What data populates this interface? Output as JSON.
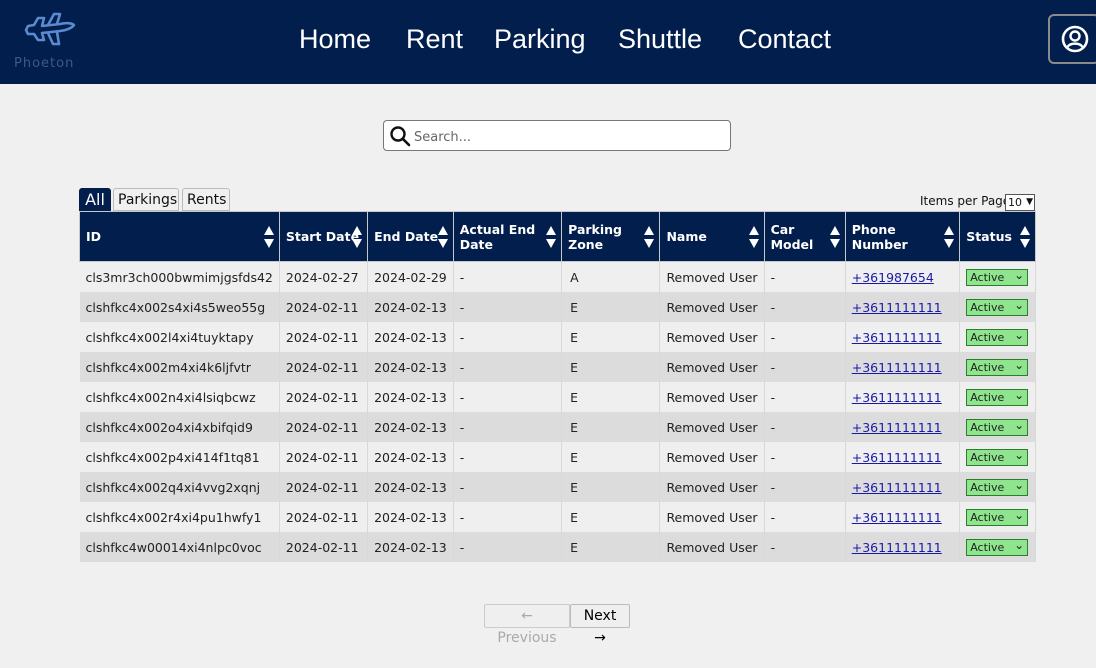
{
  "brand": {
    "name": "Phoeton"
  },
  "nav": {
    "home": "Home",
    "rent": "Rent",
    "parking": "Parking",
    "shuttle": "Shuttle",
    "contact": "Contact"
  },
  "search": {
    "placeholder": "Search..."
  },
  "filters": {
    "all": "All",
    "parkings": "Parkings",
    "rents": "Rents",
    "active": "All"
  },
  "pagination_controls": {
    "items_per_page_label": "Items per Page",
    "items_per_page_value": "10",
    "previous": "← Previous",
    "next": "Next →"
  },
  "table": {
    "headers": [
      "ID",
      "Start Date",
      "End Date",
      "Actual End Date",
      "Parking Zone",
      "Name",
      "Car Model",
      "Phone Number",
      "Status"
    ],
    "rows": [
      {
        "id": "cls3mr3ch000bwmimjgsfds42",
        "start": "2024-02-27",
        "end": "2024-02-29",
        "actual_end": "-",
        "zone": "A",
        "name": "Removed User",
        "car": "-",
        "phone": "+361987654",
        "status": "Active"
      },
      {
        "id": "clshfkc4x002s4xi4s5weo55g",
        "start": "2024-02-11",
        "end": "2024-02-13",
        "actual_end": "-",
        "zone": "E",
        "name": "Removed User",
        "car": "-",
        "phone": "+3611111111",
        "status": "Active"
      },
      {
        "id": "clshfkc4x002l4xi4tuyktapy",
        "start": "2024-02-11",
        "end": "2024-02-13",
        "actual_end": "-",
        "zone": "E",
        "name": "Removed User",
        "car": "-",
        "phone": "+3611111111",
        "status": "Active"
      },
      {
        "id": "clshfkc4x002m4xi4k6ljfvtr",
        "start": "2024-02-11",
        "end": "2024-02-13",
        "actual_end": "-",
        "zone": "E",
        "name": "Removed User",
        "car": "-",
        "phone": "+3611111111",
        "status": "Active"
      },
      {
        "id": "clshfkc4x002n4xi4lsiqbcwz",
        "start": "2024-02-11",
        "end": "2024-02-13",
        "actual_end": "-",
        "zone": "E",
        "name": "Removed User",
        "car": "-",
        "phone": "+3611111111",
        "status": "Active"
      },
      {
        "id": "clshfkc4x002o4xi4xbifqid9",
        "start": "2024-02-11",
        "end": "2024-02-13",
        "actual_end": "-",
        "zone": "E",
        "name": "Removed User",
        "car": "-",
        "phone": "+3611111111",
        "status": "Active"
      },
      {
        "id": "clshfkc4x002p4xi414f1tq81",
        "start": "2024-02-11",
        "end": "2024-02-13",
        "actual_end": "-",
        "zone": "E",
        "name": "Removed User",
        "car": "-",
        "phone": "+3611111111",
        "status": "Active"
      },
      {
        "id": "clshfkc4x002q4xi4vvg2xqnj",
        "start": "2024-02-11",
        "end": "2024-02-13",
        "actual_end": "-",
        "zone": "E",
        "name": "Removed User",
        "car": "-",
        "phone": "+3611111111",
        "status": "Active"
      },
      {
        "id": "clshfkc4x002r4xi4pu1hwfy1",
        "start": "2024-02-11",
        "end": "2024-02-13",
        "actual_end": "-",
        "zone": "E",
        "name": "Removed User",
        "car": "-",
        "phone": "+3611111111",
        "status": "Active"
      },
      {
        "id": "clshfkc4w00014xi4nlpc0voc",
        "start": "2024-02-11",
        "end": "2024-02-13",
        "actual_end": "-",
        "zone": "E",
        "name": "Removed User",
        "car": "-",
        "phone": "+3611111111",
        "status": "Active"
      }
    ]
  },
  "colors": {
    "nav_bg": "#021e4d",
    "status_active_bg": "#8ee58e",
    "link": "#1a1aa8"
  },
  "icons": {
    "logo": "airplane-icon",
    "profile": "user-circle-icon",
    "search": "search-icon",
    "sort": "sort-arrows-icon"
  }
}
